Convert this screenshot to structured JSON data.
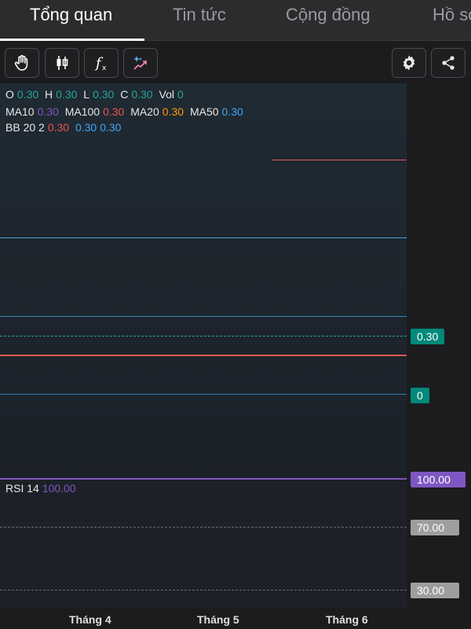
{
  "tabs": [
    {
      "label": "Tổng quan",
      "active": true
    },
    {
      "label": "Tin tức",
      "active": false
    },
    {
      "label": "Cộng đồng",
      "active": false
    },
    {
      "label": "Hồ sơ",
      "active": false
    }
  ],
  "toolbar": {
    "left_icons": [
      "hand-icon",
      "candlestick-icon",
      "function-icon",
      "ai-sparkle-icon"
    ],
    "right_icons": [
      "gear-icon",
      "share-icon"
    ]
  },
  "ohlc": {
    "o_label": "O",
    "o_value": "0.30",
    "h_label": "H",
    "h_value": "0.30",
    "l_label": "L",
    "l_value": "0.30",
    "c_label": "C",
    "c_value": "0.30",
    "vol_label": "Vol",
    "vol_value": "0"
  },
  "ma": {
    "ma10_label": "MA10",
    "ma10_value": "0.30",
    "ma100_label": "MA100",
    "ma100_value": "0.30",
    "ma20_label": "MA20",
    "ma20_value": "0.30",
    "ma50_label": "MA50",
    "ma50_value": "0.30"
  },
  "bb": {
    "label": "BB 20 2",
    "v1": "0.30",
    "v2": "0.30",
    "v3": "0.30"
  },
  "price_tags": {
    "last_price": "0.30",
    "volume": "0",
    "rsi": "100.00",
    "rsi_70": "70.00",
    "rsi_30": "30.00"
  },
  "rsi": {
    "label": "RSI 14",
    "value": "100.00"
  },
  "xaxis": [
    "Tháng 4",
    "Tháng 5",
    "Tháng 6"
  ],
  "colors": {
    "teal": "#26a69a",
    "purple": "#7e57c2",
    "red": "#ef5350",
    "orange": "#ff9800",
    "blue": "#42a5f5",
    "tag_teal": "#00897b",
    "tag_purple": "#7e57c2",
    "tag_gray": "#9e9e9e"
  }
}
